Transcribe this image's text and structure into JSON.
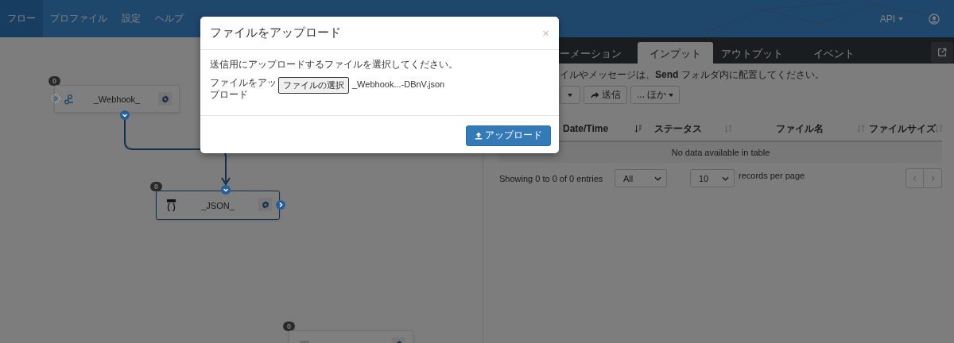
{
  "navbar": {
    "items": [
      {
        "label": "フロー",
        "selected": true
      },
      {
        "label": "プロファイル",
        "selected": false
      },
      {
        "label": "設定",
        "selected": false
      },
      {
        "label": "ヘルプ",
        "selected": false
      }
    ],
    "api_menu": "API"
  },
  "canvas": {
    "nodes": [
      {
        "kind": "webhook",
        "label": "_Webhook_",
        "count": "0"
      },
      {
        "kind": "json",
        "label": "_JSON_",
        "count": "0"
      },
      {
        "kind": "plain",
        "count": "0"
      }
    ]
  },
  "panel": {
    "tabs": [
      {
        "label": "ーメーション",
        "selected": false
      },
      {
        "label": "インプット",
        "selected": true
      },
      {
        "label": "アウトプット",
        "selected": false
      },
      {
        "label": "イベント",
        "selected": false
      }
    ],
    "hint": "イルやメッセージは、**Send** フォルダ内に配置してください。",
    "buttons": [
      {
        "kind": "caret"
      },
      {
        "kind": "send",
        "label": "送信"
      },
      {
        "kind": "more",
        "label": "... ほか"
      }
    ],
    "table": {
      "columns": [
        "Date/Time",
        "ステータス",
        "ファイル名",
        "ファイルサイズ"
      ],
      "empty": "No data available in table"
    },
    "info": "Showing 0 to 0 of 0 entries",
    "filter": "All",
    "page_size": "10",
    "page_size_label": "records per page"
  },
  "modal": {
    "title": "ファイルをアップロード",
    "close": "×",
    "message": "送信用にアップロードするファイルを選択してください。",
    "field_label": "ファイルをアップロード",
    "file_button": "ファイルの選択",
    "file_name": "_Webhook...-DBnV.json",
    "submit": "アップロード"
  }
}
